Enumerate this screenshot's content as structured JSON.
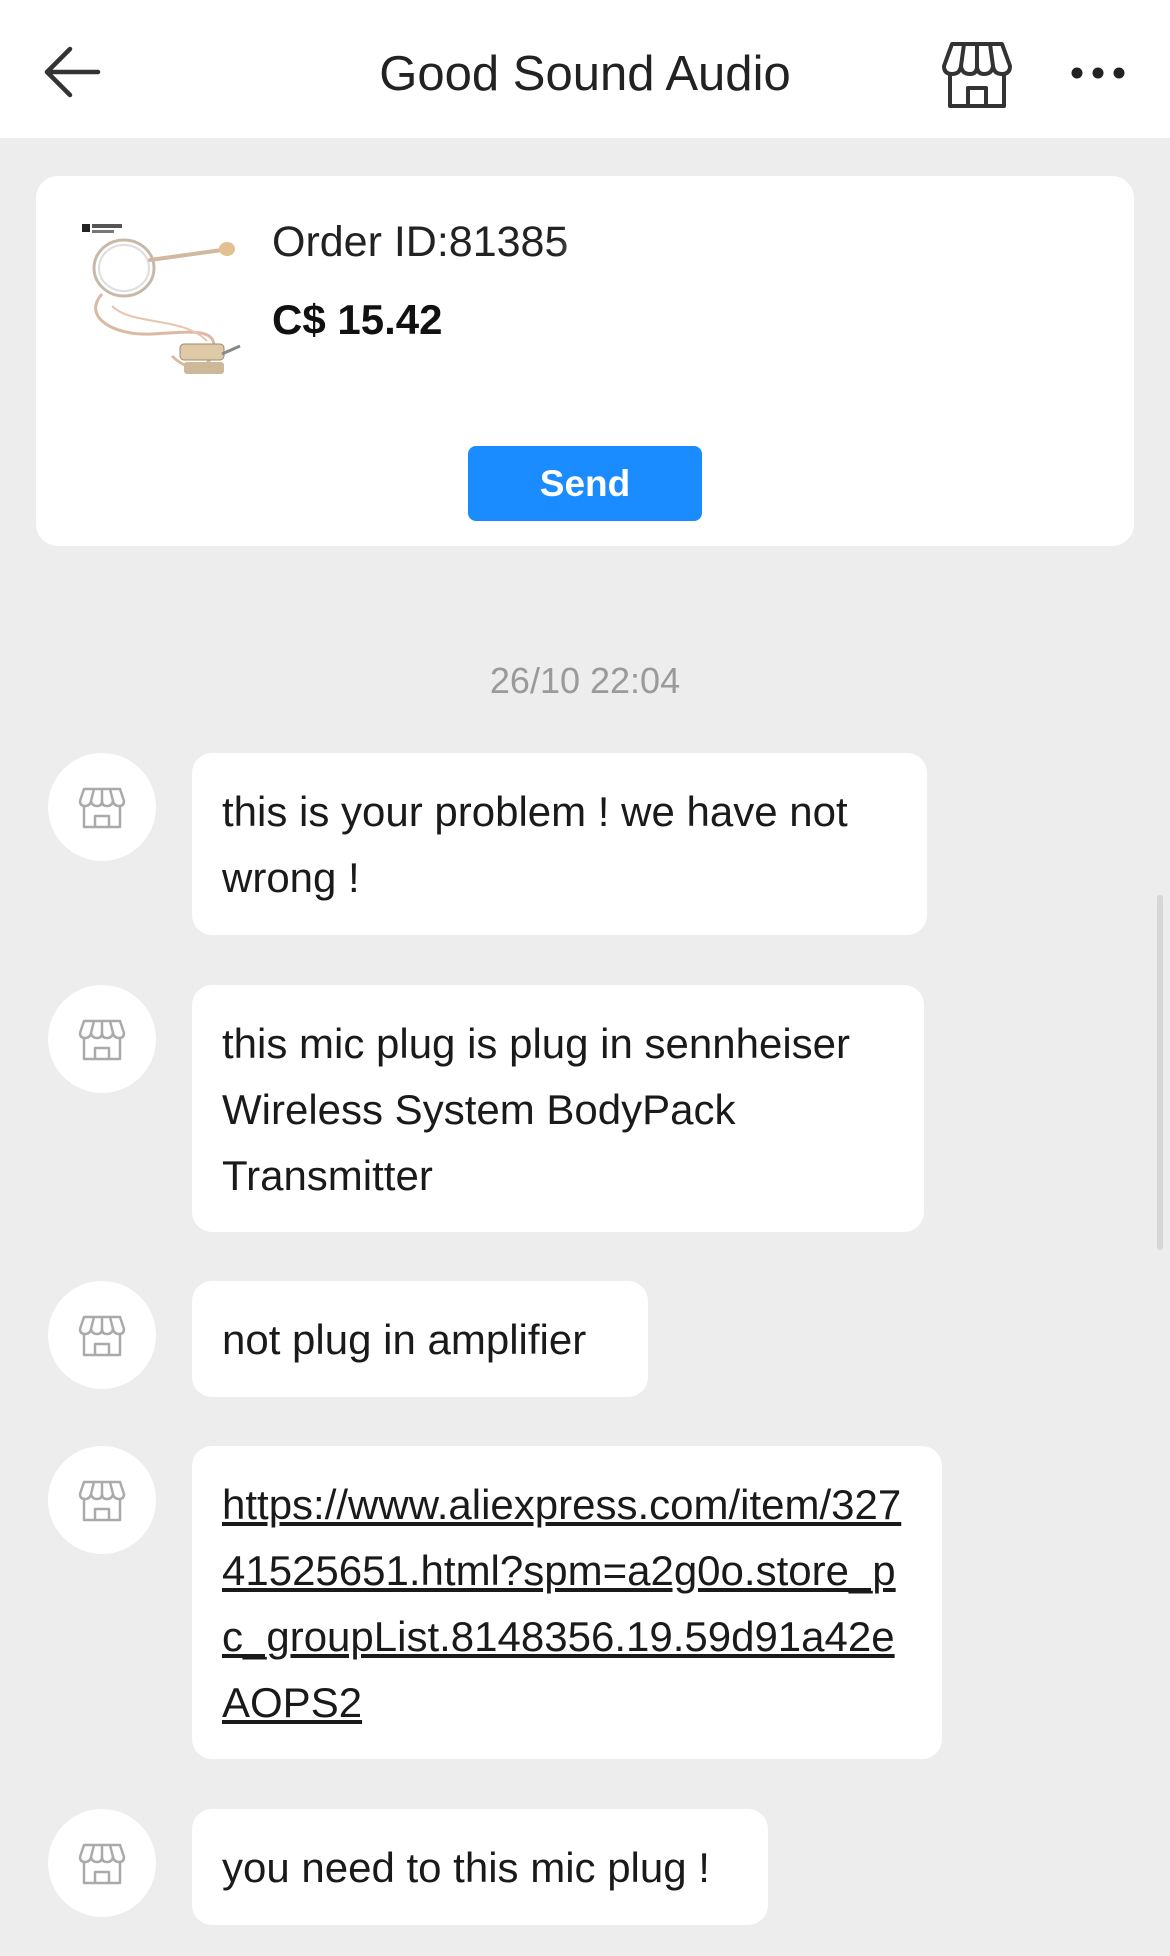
{
  "header": {
    "title": "Good Sound Audio",
    "back_icon": "arrow-left-icon",
    "store_icon": "store-icon",
    "more_icon": "more-dots-icon"
  },
  "order": {
    "id_label": "Order ID:81385",
    "price": "C$ 15.42",
    "send_label": "Send",
    "image": "headset-microphone-product-photo"
  },
  "chat": {
    "timestamp": "26/10 22:04",
    "messages": [
      {
        "text": "this is your problem ! we have not wrong !"
      },
      {
        "text": "this mic plug is plug in sennheiser Wireless System BodyPack Transmitter"
      },
      {
        "text": "not plug in amplifier"
      },
      {
        "text": "https://www.aliexpress.com/item/32741525651.html?spm=a2g0o.store_pc_groupList.8148356.19.59d91a42eAOPS2"
      },
      {
        "text": "you need to this mic plug !"
      }
    ]
  },
  "colors": {
    "accent": "#1a8cff",
    "background": "#ededed",
    "bubble": "#ffffff"
  }
}
